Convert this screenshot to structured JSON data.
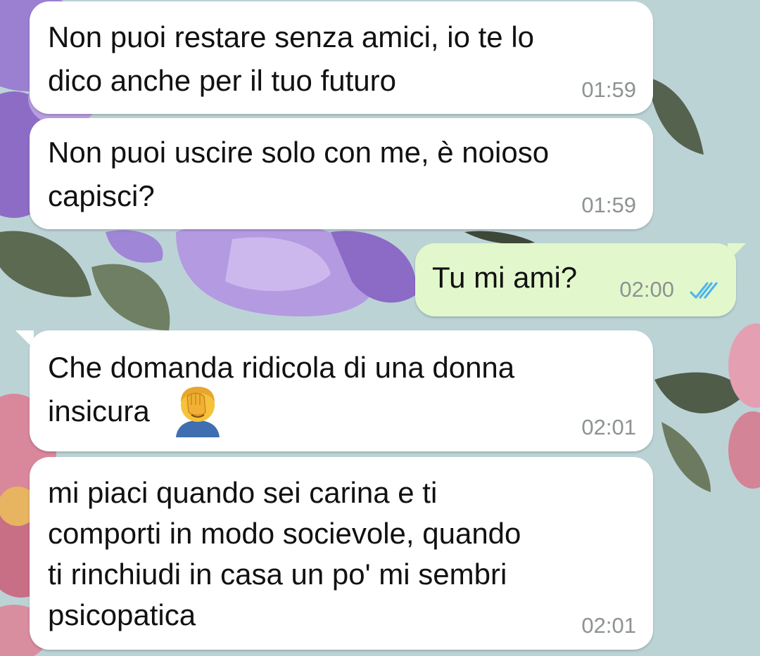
{
  "chat": {
    "messages": [
      {
        "direction": "incoming",
        "text": "Non puoi restare senza amici, io te lo\ndico anche per il tuo futuro",
        "time": "01:59"
      },
      {
        "direction": "incoming",
        "text": "Non puoi uscire solo con me, è noioso\ncapisci?",
        "time": "01:59"
      },
      {
        "direction": "outgoing",
        "text": "Tu mi ami?",
        "time": "02:00",
        "status": "read",
        "status_icon": "double-check-icon",
        "status_color": "#4fb6ec"
      },
      {
        "direction": "incoming",
        "text": "Che domanda ridicola di una donna\ninsicura",
        "emoji": "facepalm-emoji",
        "time": "02:01"
      },
      {
        "direction": "incoming",
        "text": "mi piaci quando sei carina e ti\ncomporti in modo socievole, quando\nti rinchiudi in casa un po' mi sembri\npsicopatica",
        "time": "02:01"
      }
    ]
  },
  "colors": {
    "incoming_bubble": "#ffffff",
    "outgoing_bubble": "#e2f8cc",
    "timestamp": "#8d9293",
    "wallpaper_base": "#bcd3d6"
  }
}
